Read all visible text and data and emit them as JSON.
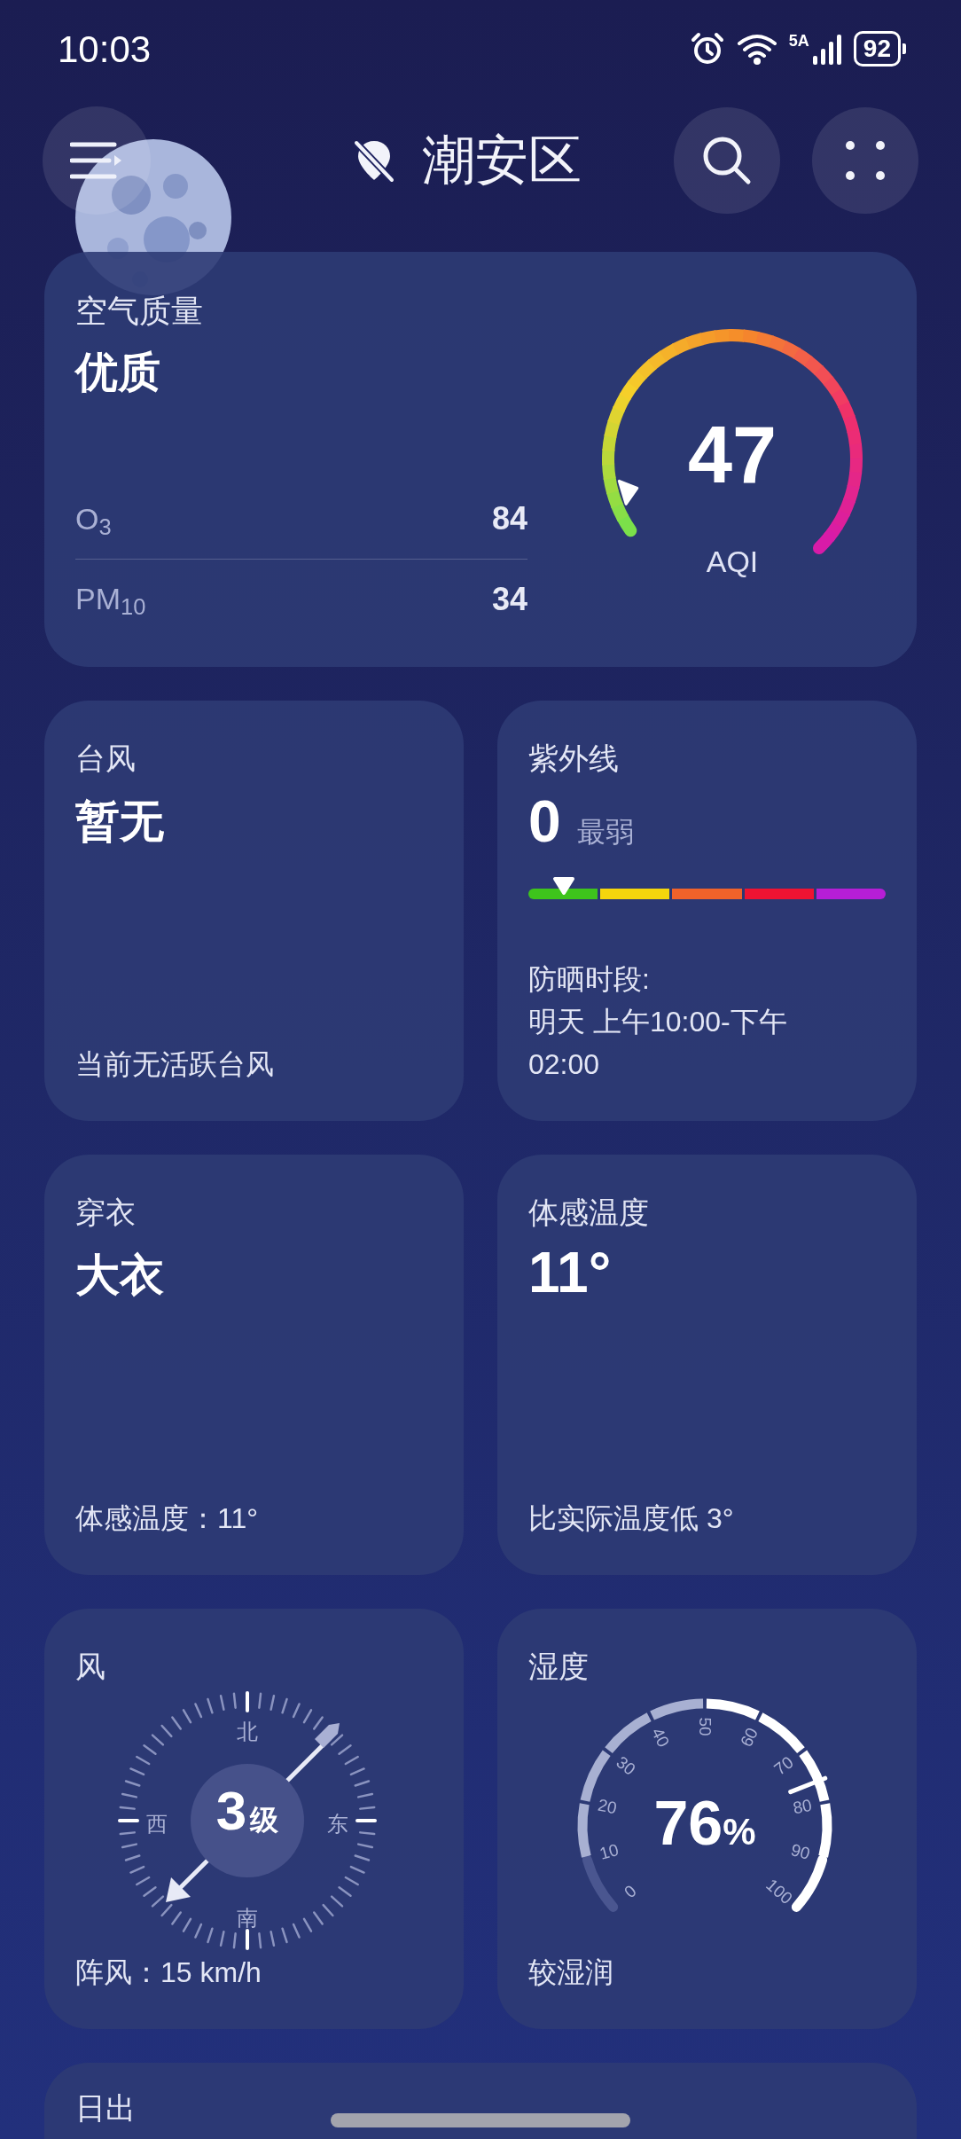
{
  "status_bar": {
    "time": "10:03",
    "network": "5A",
    "battery": "92"
  },
  "header": {
    "location": "潮安区"
  },
  "air_quality": {
    "title": "空气质量",
    "rating": "优质",
    "aqi": "47",
    "aqi_label": "AQI",
    "pollutants": [
      {
        "name": "O$_{3}$",
        "value": "84"
      },
      {
        "name": "PM$_{10}$",
        "value": "34"
      }
    ]
  },
  "typhoon": {
    "title": "台风",
    "value": "暂无",
    "note": "当前无活跃台风"
  },
  "uv": {
    "title": "紫外线",
    "value": "0",
    "rating": "最弱",
    "segments": [
      {
        "color": "#3ec41c"
      },
      {
        "color": "#f5d60c"
      },
      {
        "color": "#f0622a"
      },
      {
        "color": "#ee1332"
      },
      {
        "color": "#b61ed6"
      }
    ],
    "protection_label": "防晒时段:",
    "protection_time": "明天 上午10:00-下午02:00"
  },
  "clothing": {
    "title": "穿衣",
    "value": "大衣",
    "note": "体感温度：11°"
  },
  "feels_like": {
    "title": "体感温度",
    "value": "11°",
    "note": "比实际温度低 3°"
  },
  "wind": {
    "title": "风",
    "grade": "3",
    "grade_unit": "级",
    "north": "北",
    "east": "东",
    "south": "南",
    "west": "西",
    "gust": "阵风：15 km/h"
  },
  "humidity": {
    "title": "湿度",
    "value": "76",
    "unit": "%",
    "ticks": [
      "0",
      "10",
      "20",
      "30",
      "40",
      "50",
      "60",
      "70",
      "80",
      "90",
      "100"
    ],
    "note": "较湿润"
  },
  "sunrise": {
    "title": "日出"
  }
}
